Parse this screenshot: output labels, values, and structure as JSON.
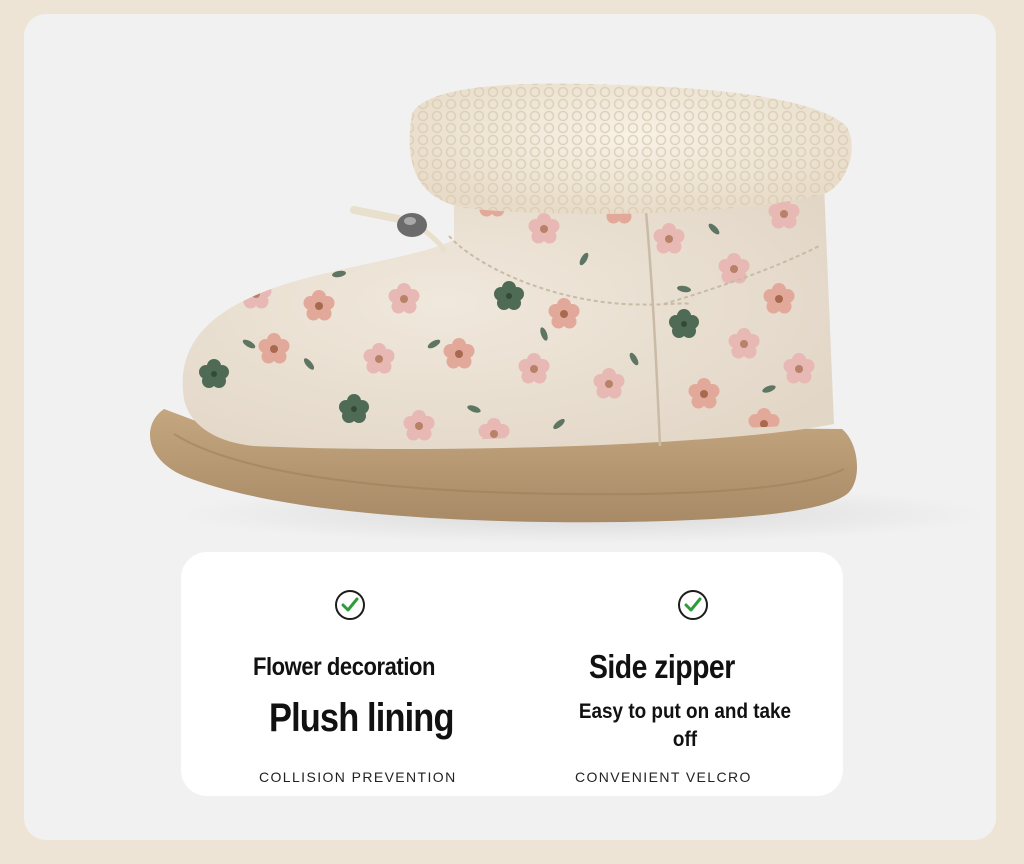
{
  "image": {
    "subject": "boot-icon",
    "background_color": "#ede4d6",
    "card_color": "#f1f1f1"
  },
  "features": {
    "check_color": "#2e9c3a",
    "left": {
      "check_icon": "check-circle-icon",
      "subtitle": "Flower decoration",
      "title": "Plush lining",
      "caption": "COLLISION PREVENTION"
    },
    "right": {
      "check_icon": "check-circle-icon",
      "title": "Side zipper",
      "description": "Easy to put on and take off",
      "caption": "CONVENIENT VELCRO"
    }
  }
}
